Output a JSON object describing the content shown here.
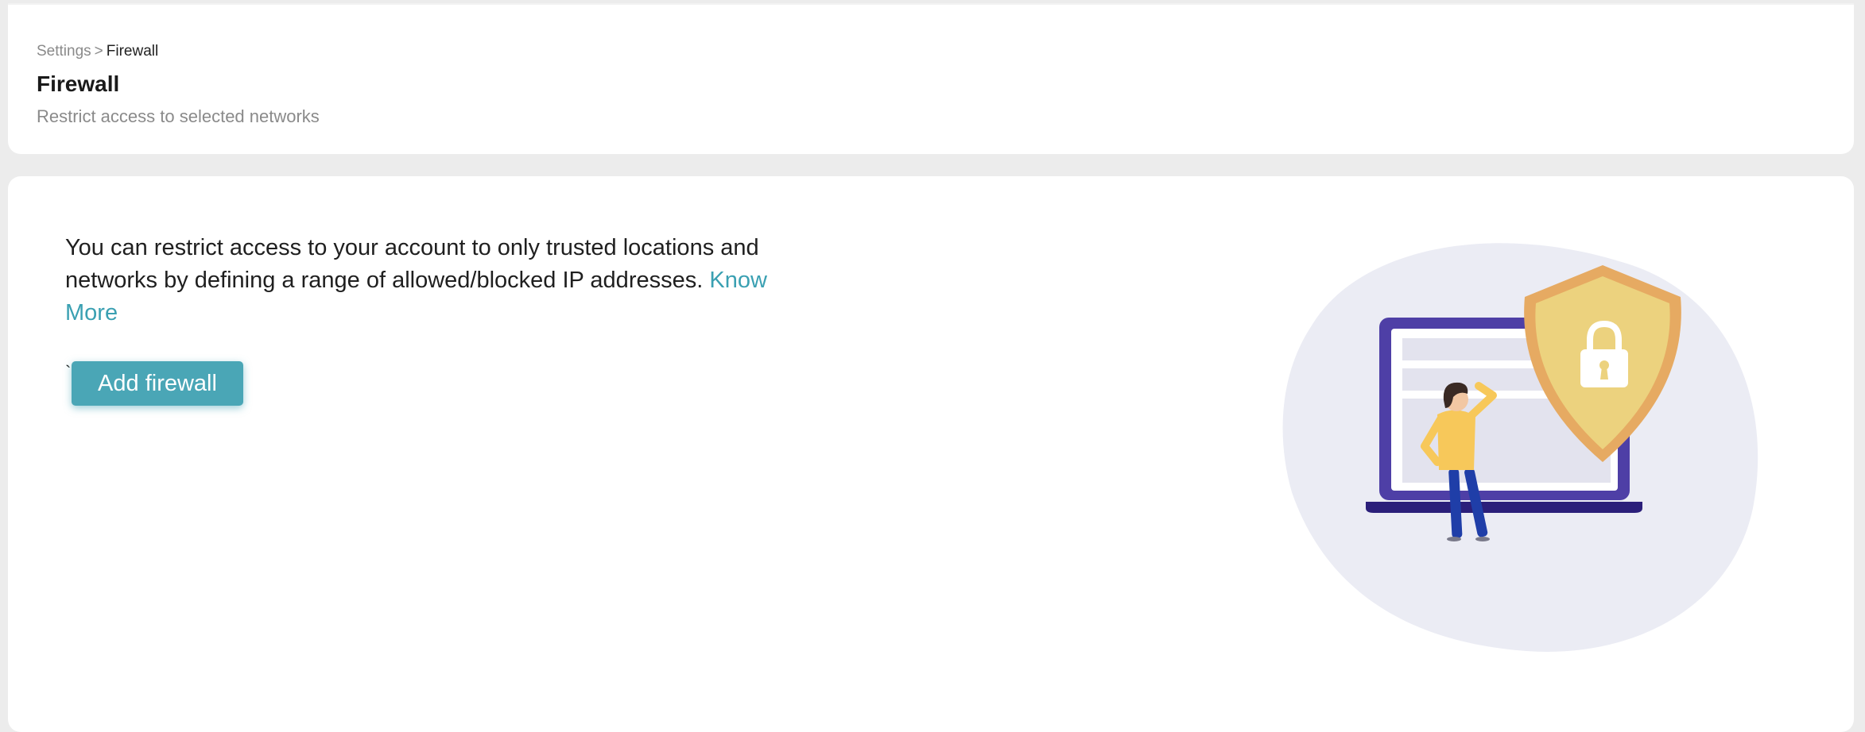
{
  "breadcrumb": {
    "parent": "Settings",
    "separator": ">",
    "current": "Firewall"
  },
  "header": {
    "title": "Firewall",
    "subtitle": "Restrict access to selected networks"
  },
  "main": {
    "description": "You can restrict access to your account to only trusted locations and networks by defining a range of allowed/blocked IP addresses.",
    "know_more_label": "Know More",
    "stray_mark": "`",
    "add_button_label": "Add firewall"
  },
  "illustration": {
    "icons": [
      "laptop-icon",
      "shield-icon",
      "lock-icon",
      "person-icon"
    ],
    "colors": {
      "blob": "#ebecf4",
      "laptop_frame": "#4e3fa6",
      "laptop_base": "#2b1f7a",
      "shield_outer": "#e6aa62",
      "shield_inner": "#ecd27e",
      "person_shirt": "#f7c85a",
      "person_pants": "#1f3ea8",
      "person_hair": "#3a2a24"
    }
  },
  "colors": {
    "accent": "#4aa6b6",
    "link": "#3aa0b2",
    "page_background": "#ececec",
    "card_background": "#ffffff"
  }
}
